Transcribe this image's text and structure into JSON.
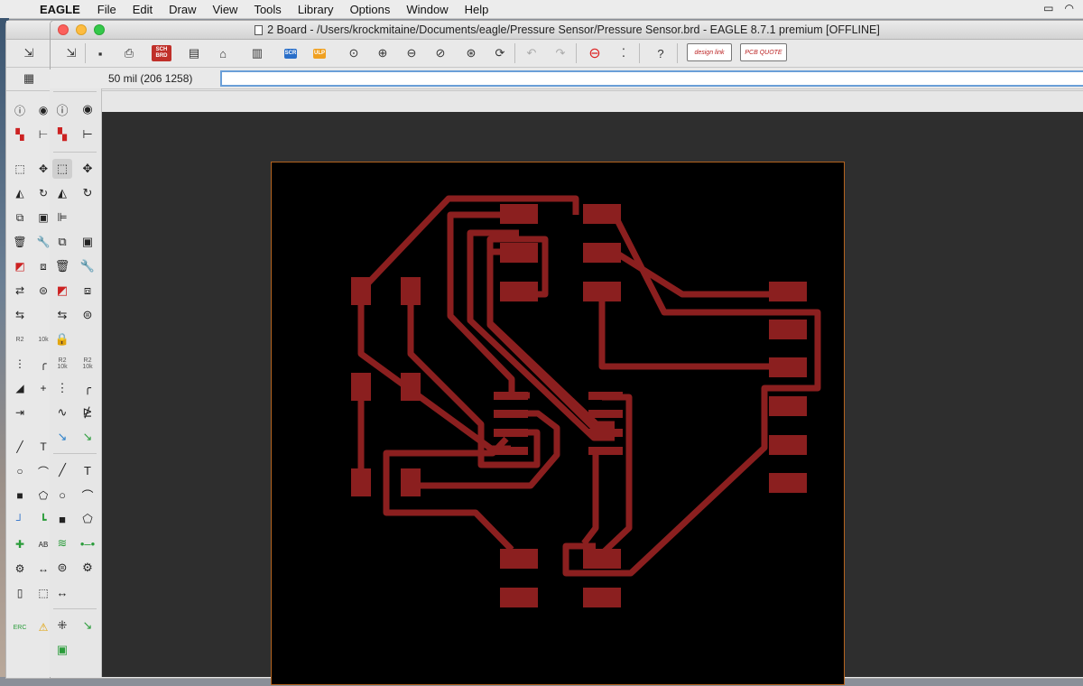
{
  "menubar": {
    "apple_icon": "apple-logo-icon",
    "app_name": "EAGLE",
    "items": [
      "File",
      "Edit",
      "Draw",
      "View",
      "Tools",
      "Library",
      "Options",
      "Window",
      "Help"
    ]
  },
  "window": {
    "title": "2 Board - /Users/krockmitaine/Documents/eagle/Pressure Sensor/Pressure Sensor.brd - EAGLE 8.7.1 premium [OFFLINE]"
  },
  "toolbar": {
    "sch_label": "SCH BRD",
    "scr_label": "SCR",
    "ulp_label": "ULP",
    "designlink_label": "design link",
    "pcbquote_label": "PCB QUOTE"
  },
  "command_bar": {
    "grid_readout": "50 mil (206 1258)",
    "command_value": ""
  },
  "palette": {
    "erc_label": "ERC",
    "r_label_1": "R2 10k",
    "r_label_2": "R2 10k"
  },
  "colors": {
    "copper": "#8b1f1f",
    "board_outline": "#b4631e",
    "canvas_bg": "#2e2e2e",
    "board_bg": "#000000"
  }
}
